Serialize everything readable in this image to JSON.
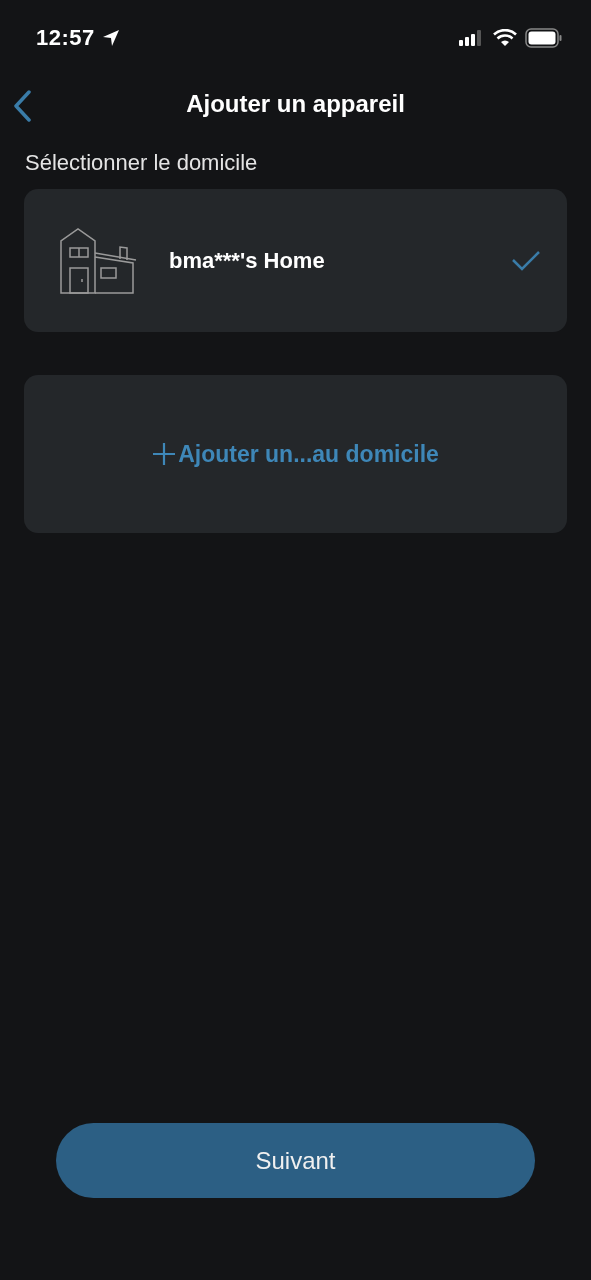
{
  "status_bar": {
    "time": "12:57"
  },
  "nav": {
    "title": "Ajouter un appareil"
  },
  "section_label": "Sélectionner le domicile",
  "homes": [
    {
      "name": "bma***'s Home",
      "selected": true
    }
  ],
  "add_home": {
    "label": "Ajouter un...au domicile"
  },
  "next_button": {
    "label": "Suivant"
  }
}
